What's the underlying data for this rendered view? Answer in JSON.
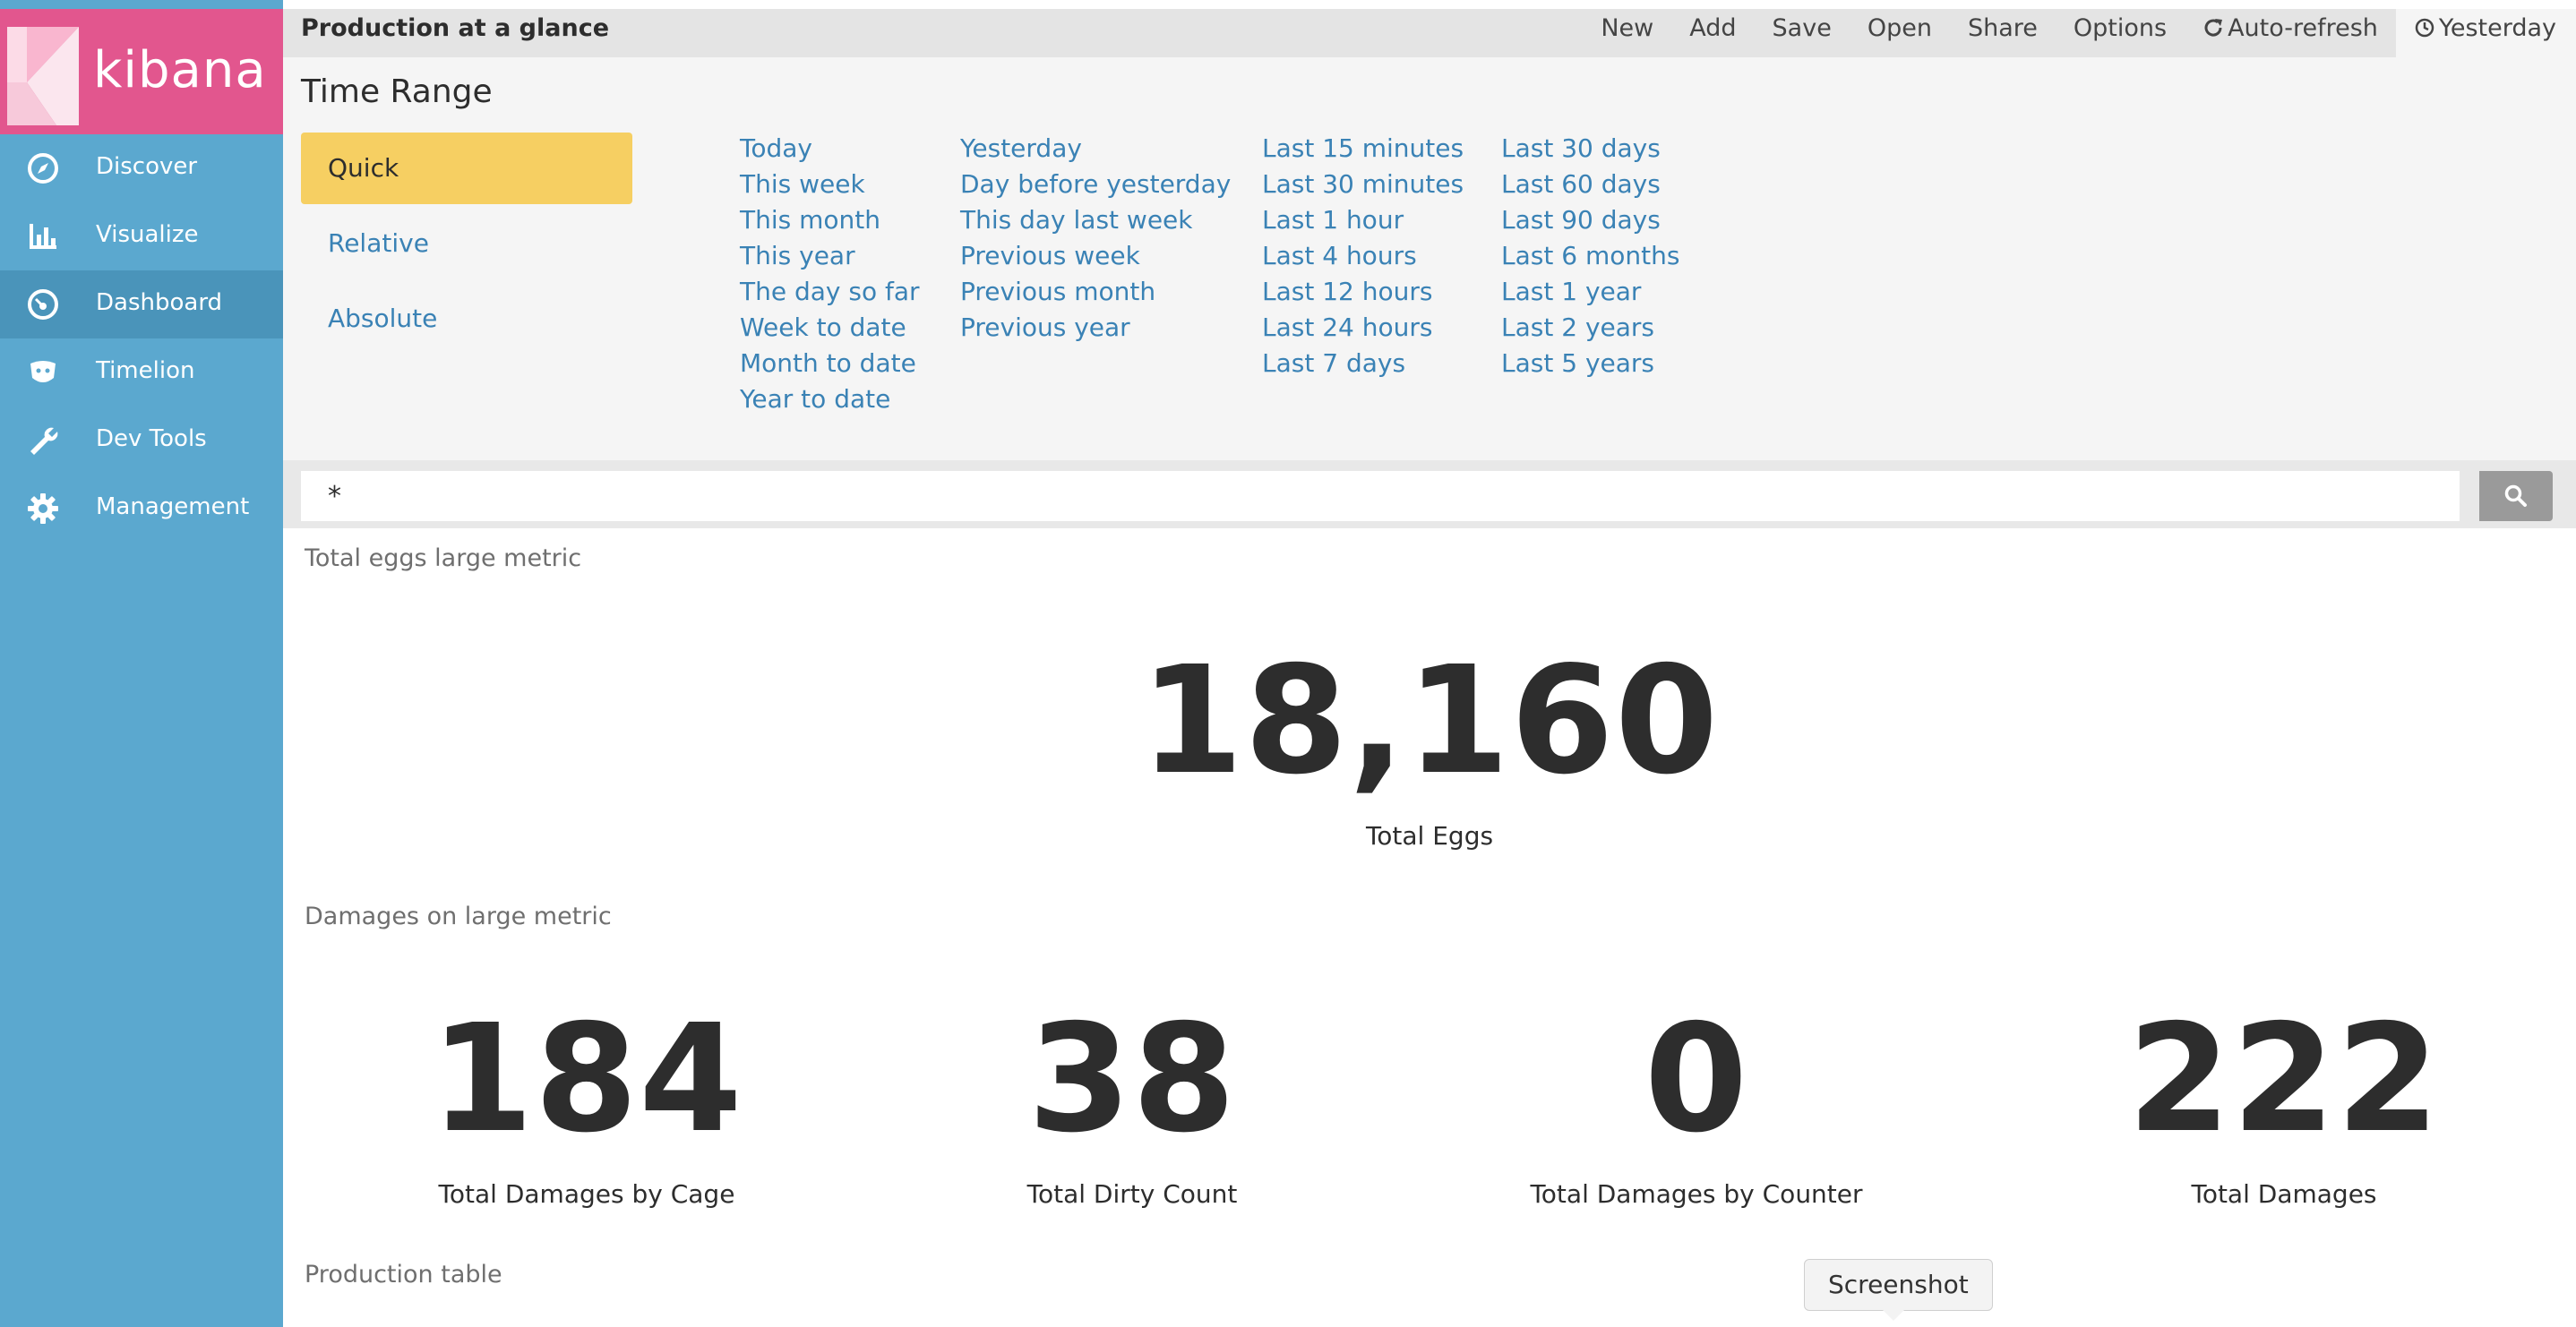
{
  "brand": {
    "name": "kibana",
    "colors": {
      "brand_pink": "#e2568e",
      "sidebar_blue": "#5ba8cf",
      "accent_yellow": "#f6cf62",
      "link_blue": "#3a82b5"
    }
  },
  "sidebar": {
    "items": [
      {
        "label": "Discover",
        "icon": "compass-icon",
        "active": false
      },
      {
        "label": "Visualize",
        "icon": "bar-chart-icon",
        "active": false
      },
      {
        "label": "Dashboard",
        "icon": "dashboard-gauge-icon",
        "active": true
      },
      {
        "label": "Timelion",
        "icon": "timelion-icon",
        "active": false
      },
      {
        "label": "Dev Tools",
        "icon": "wrench-icon",
        "active": false
      },
      {
        "label": "Management",
        "icon": "gear-icon",
        "active": false
      }
    ]
  },
  "topbar": {
    "title": "Production at a glance",
    "menu": {
      "new": "New",
      "add": "Add",
      "save": "Save",
      "open": "Open",
      "share": "Share",
      "options": "Options",
      "auto_refresh": "Auto-refresh",
      "time": "Yesterday"
    }
  },
  "time_range": {
    "heading": "Time Range",
    "modes": [
      "Quick",
      "Relative",
      "Absolute"
    ],
    "selected_mode": "Quick",
    "quick_columns": [
      [
        "Today",
        "This week",
        "This month",
        "This year",
        "The day so far",
        "Week to date",
        "Month to date",
        "Year to date"
      ],
      [
        "Yesterday",
        "Day before yesterday",
        "This day last week",
        "Previous week",
        "Previous month",
        "Previous year"
      ],
      [
        "Last 15 minutes",
        "Last 30 minutes",
        "Last 1 hour",
        "Last 4 hours",
        "Last 12 hours",
        "Last 24 hours",
        "Last 7 days"
      ],
      [
        "Last 30 days",
        "Last 60 days",
        "Last 90 days",
        "Last 6 months",
        "Last 1 year",
        "Last 2 years",
        "Last 5 years"
      ]
    ]
  },
  "query": {
    "value": "*"
  },
  "panels": {
    "eggs": {
      "title": "Total eggs large metric",
      "value": "18,160",
      "label": "Total Eggs"
    },
    "damages": {
      "title": "Damages on large metric",
      "metrics": [
        {
          "value": "184",
          "label": "Total Damages by Cage"
        },
        {
          "value": "38",
          "label": "Total Dirty Count"
        },
        {
          "value": "0",
          "label": "Total Damages by Counter"
        },
        {
          "value": "222",
          "label": "Total Damages"
        }
      ]
    },
    "table": {
      "title": "Production table"
    }
  },
  "tooltip": {
    "text": "Screenshot"
  }
}
